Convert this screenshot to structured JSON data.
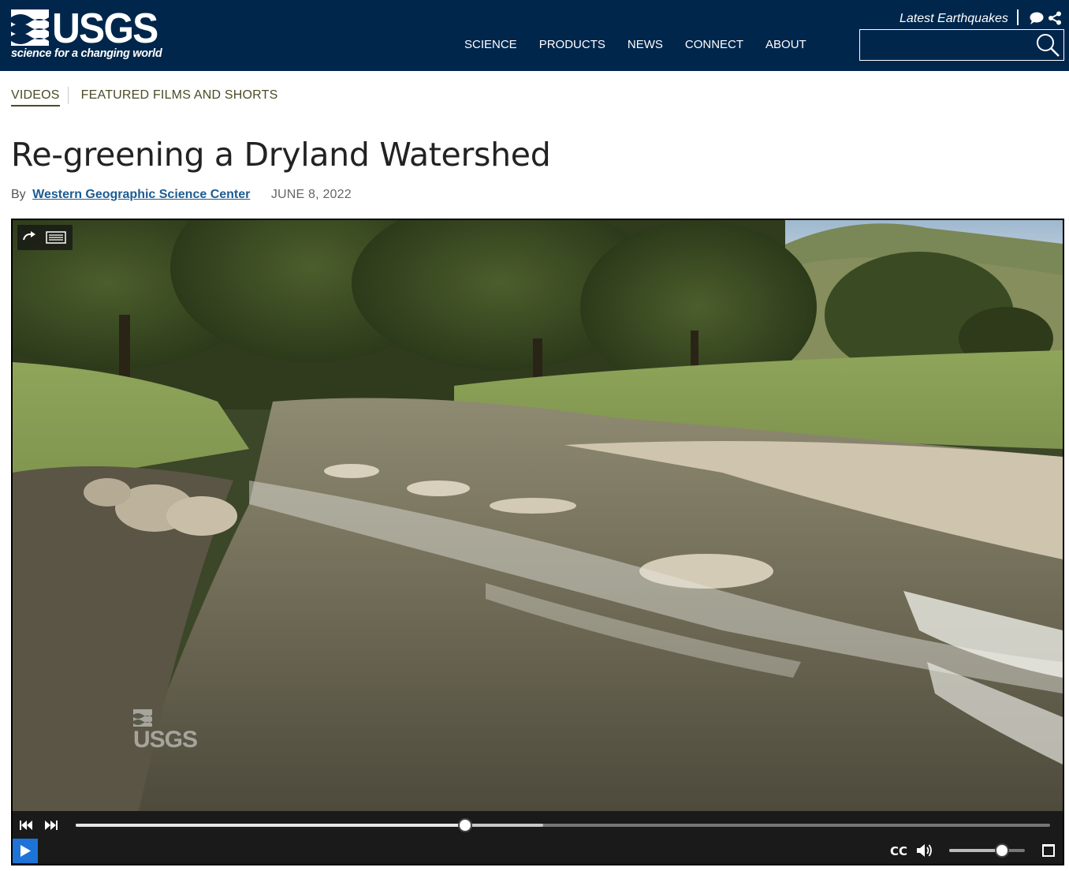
{
  "header": {
    "logo_text": "USGS",
    "logo_tagline": "science for a changing world",
    "nav": [
      "SCIENCE",
      "PRODUCTS",
      "NEWS",
      "CONNECT",
      "ABOUT"
    ],
    "earthquakes_link": "Latest Earthquakes",
    "search": {
      "value": "",
      "placeholder": ""
    },
    "icons": {
      "chat": "chat-bubble-icon",
      "share": "share-icon",
      "search": "search-icon"
    }
  },
  "breadcrumb": {
    "active": "VIDEOS",
    "current": "FEATURED FILMS AND SHORTS"
  },
  "page": {
    "title": "Re-greening a Dryland Watershed",
    "by_label": "By",
    "author": "Western Geographic Science Center",
    "date": "JUNE 8, 2022"
  },
  "video": {
    "watermark": "USGS",
    "progress_played": 0.4,
    "progress_buffered": 0.48,
    "volume": 0.7,
    "state": "paused",
    "colors": {
      "play_button": "#1e73d8",
      "control_bar": "#1a1a1a"
    }
  },
  "colors": {
    "header_bg": "#00264c",
    "breadcrumb": "#4b4b26",
    "author_link": "#1d5b91"
  }
}
